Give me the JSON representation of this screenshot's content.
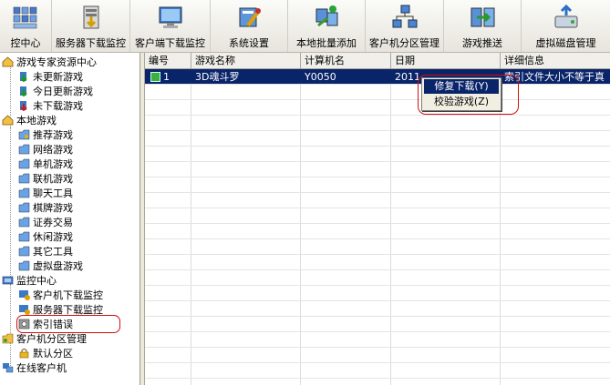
{
  "toolbar": {
    "items": [
      {
        "label": "控中心"
      },
      {
        "label": "服务器下载监控"
      },
      {
        "label": "客户端下载监控"
      },
      {
        "label": "系统设置"
      },
      {
        "label": "本地批量添加"
      },
      {
        "label": "客户机分区管理"
      },
      {
        "label": "游戏推送"
      },
      {
        "label": "虚拟磁盘管理"
      }
    ]
  },
  "tree": {
    "n0": "游戏专家资源中心",
    "n1": "未更新游戏",
    "n2": "今日更新游戏",
    "n3": "未下载游戏",
    "n4": "本地游戏",
    "n5": "推荐游戏",
    "n6": "网络游戏",
    "n7": "单机游戏",
    "n8": "联机游戏",
    "n9": "聊天工具",
    "n10": "棋牌游戏",
    "n11": "证券交易",
    "n12": "休闲游戏",
    "n13": "其它工具",
    "n14": "虚拟盘游戏",
    "n15": "监控中心",
    "n16": "客户机下载监控",
    "n17": "服务器下载监控",
    "n18": "索引错误",
    "n19": "客户机分区管理",
    "n20": "默认分区",
    "n21": "在线客户机"
  },
  "grid": {
    "columns": [
      "编号",
      "游戏名称",
      "计算机名",
      "日期",
      "详细信息"
    ],
    "rows": [
      {
        "id": "1",
        "name": "3D魂斗罗",
        "computer": "Y0050",
        "date": "2011",
        "detail": "索引文件大小不等于真"
      }
    ]
  },
  "context_menu": {
    "items": [
      "修复下载(Y)",
      "校验游戏(Z)"
    ]
  },
  "colors": {
    "selection": "#0a246a",
    "annotation_red": "#d01010"
  }
}
